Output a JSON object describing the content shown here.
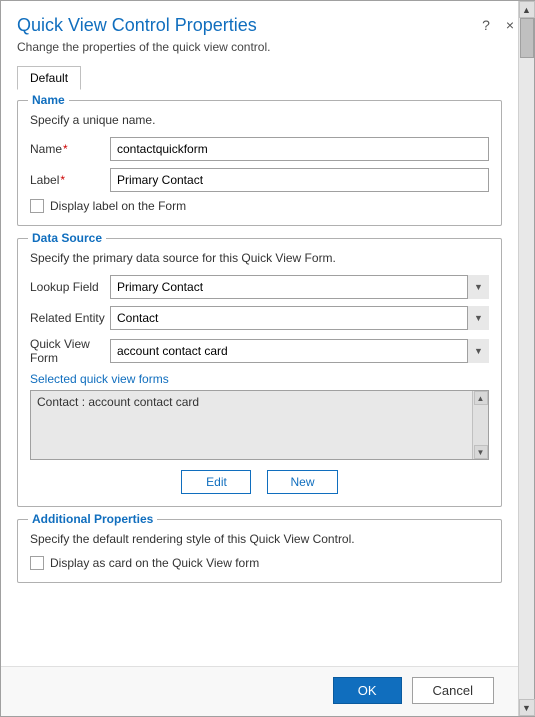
{
  "dialog": {
    "title": "Quick View Control Properties",
    "subtitle": "Change the properties of the quick view control.",
    "help_icon": "?",
    "close_icon": "×"
  },
  "tabs": [
    {
      "label": "Default",
      "active": true
    }
  ],
  "name_section": {
    "legend": "Name",
    "description": "Specify a unique name.",
    "name_label": "Name",
    "name_required": "*",
    "name_value": "contactquickform",
    "label_label": "Label",
    "label_required": "*",
    "label_value": "Primary Contact",
    "checkbox_label": "Display label on the Form"
  },
  "datasource_section": {
    "legend": "Data Source",
    "description": "Specify the primary data source for this Quick View Form.",
    "lookup_label": "Lookup Field",
    "lookup_value": "Primary Contact",
    "lookup_options": [
      "Primary Contact"
    ],
    "related_label": "Related Entity",
    "related_value": "Contact",
    "related_options": [
      "Contact"
    ],
    "quickview_label": "Quick View Form",
    "quickview_value": "account contact card",
    "quickview_options": [
      "account contact card"
    ],
    "selected_label": "Selected quick view forms",
    "selected_item": "Contact : account contact card",
    "edit_button": "Edit",
    "new_button": "New"
  },
  "additional_section": {
    "legend": "Additional Properties",
    "description": "Specify the default rendering style of this Quick View Control.",
    "checkbox_label": "Display as card on the Quick View form"
  },
  "footer": {
    "ok_label": "OK",
    "cancel_label": "Cancel"
  }
}
